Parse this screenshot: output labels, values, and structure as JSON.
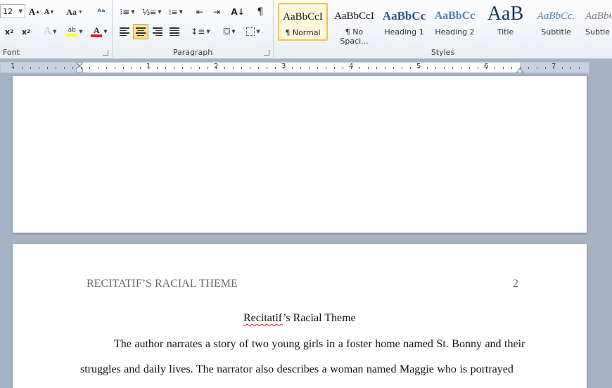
{
  "font_group": {
    "size_value": "12",
    "label": "Font",
    "change_case_label": "Aa"
  },
  "paragraph_group": {
    "label": "Paragraph"
  },
  "styles_group": {
    "label": "Styles",
    "items": [
      {
        "sample": "AaBbCcI",
        "name": "¶ Normal"
      },
      {
        "sample": "AaBbCcI",
        "name": "¶ No Spaci..."
      },
      {
        "sample": "AaBbCc",
        "name": "Heading 1"
      },
      {
        "sample": "AaBbCc",
        "name": "Heading 2"
      },
      {
        "sample": "AaB",
        "name": "Title"
      },
      {
        "sample": "AaBbCc.",
        "name": "Subtitle"
      },
      {
        "sample": "AaBbC",
        "name": "Subtle"
      }
    ]
  },
  "ruler": {
    "numbers": [
      "1",
      "1",
      "2",
      "3",
      "4",
      "5",
      "6",
      "7"
    ]
  },
  "document": {
    "header_text": "RECITATIF’S RACIAL THEME",
    "page_number": "2",
    "title_word1": "Recitatif",
    "title_rest": "’s Racial Theme",
    "para_line1": "The author narrates a story of two young girls in a foster home named St. Bonny and their",
    "para_line2": "struggles and daily lives. The narrator also describes a woman named Maggie who is portrayed"
  },
  "colors": {
    "ribbon_bg": "#e9eef5",
    "selected_style": "#f1c14b",
    "workspace": "#a7b3c4",
    "spell_error": "#e02020"
  }
}
